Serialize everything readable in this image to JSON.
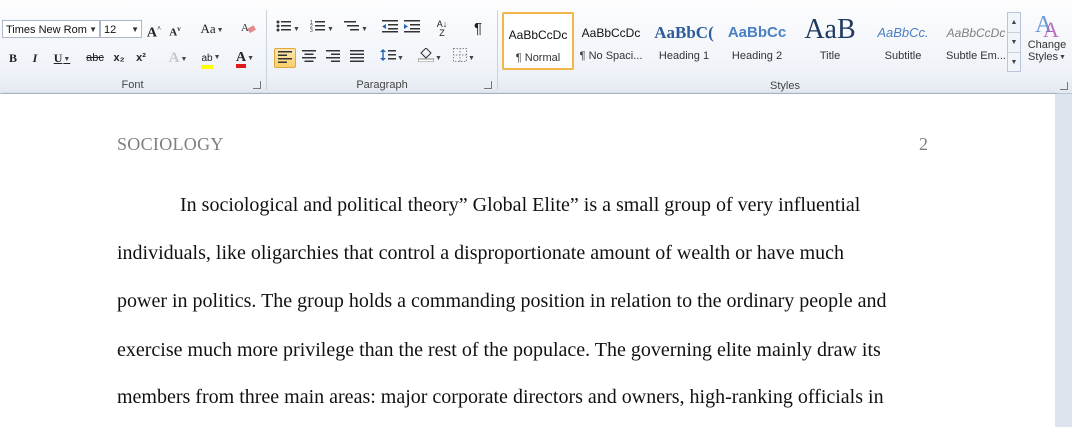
{
  "ribbon": {
    "font_group": {
      "label": "Font",
      "font_name": "Times New Rom",
      "font_size": "12",
      "grow_font": "A",
      "shrink_font": "A",
      "change_case": "Aa",
      "bold": "B",
      "italic": "I",
      "underline": "U",
      "strikethrough": "abc",
      "subscript": "x₂",
      "superscript": "x²",
      "text_effects": "A",
      "highlight": "ab",
      "font_color": "A"
    },
    "paragraph_group": {
      "label": "Paragraph",
      "sort": "A↓Z",
      "show_marks": "¶"
    },
    "styles_group": {
      "label": "Styles",
      "tiles": [
        {
          "sample": "AaBbCcDc",
          "name": "¶ Normal"
        },
        {
          "sample": "AaBbCcDc",
          "name": "¶ No Spaci..."
        },
        {
          "sample": "AaBbC(",
          "name": "Heading 1"
        },
        {
          "sample": "AaBbCc",
          "name": "Heading 2"
        },
        {
          "sample": "AaB",
          "name": "Title"
        },
        {
          "sample": "AaBbCc.",
          "name": "Subtitle"
        },
        {
          "sample": "AaBbCcDc",
          "name": "Subtle Em..."
        }
      ],
      "change_styles_line1": "Change",
      "change_styles_line2": "Styles"
    }
  },
  "document": {
    "header_title": "SOCIOLOGY",
    "page_number": "2",
    "lines": [
      "In sociological and political theory” Global Elite” is a small group of very influential",
      "individuals, like oligarchies that control a disproportionate amount of wealth or have much",
      "power in politics. The group holds a commanding position in relation to the ordinary people and",
      "exercise much more privilege than the rest of the populace. The governing elite mainly draw its",
      "members  from three main areas:  major corporate directors and owners, high-ranking officials in"
    ]
  }
}
